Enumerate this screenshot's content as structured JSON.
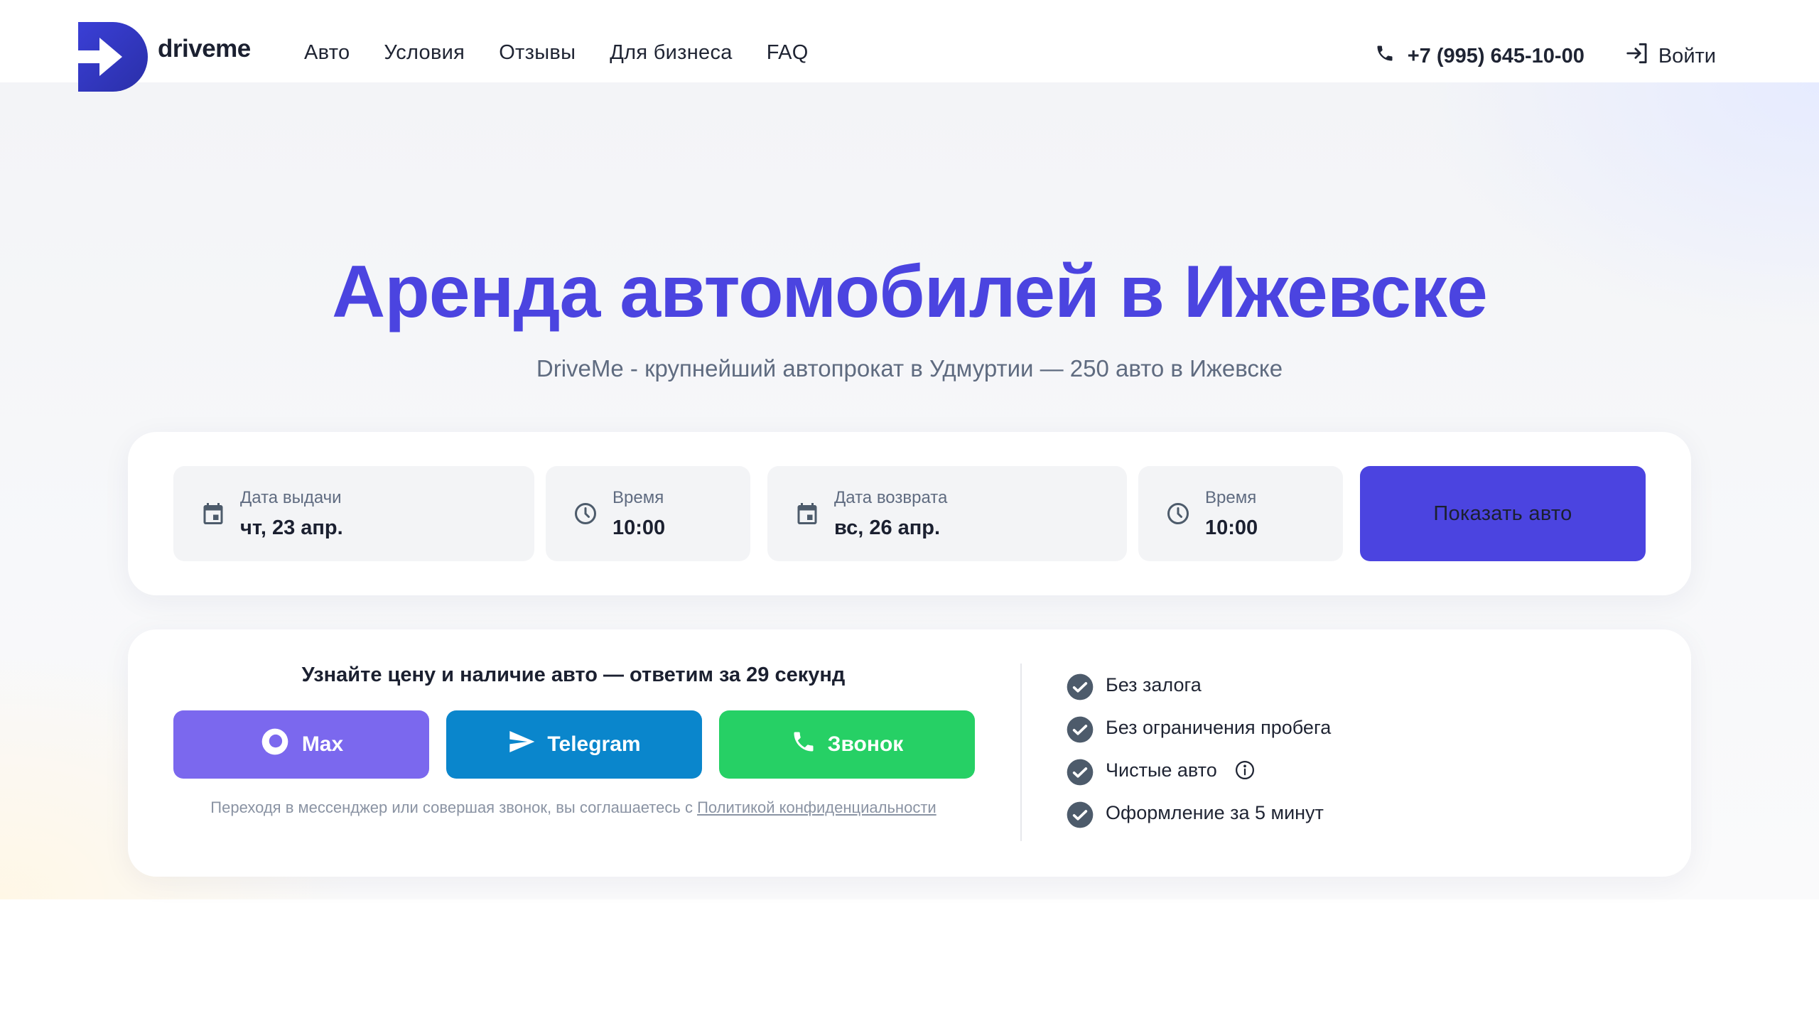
{
  "brand": {
    "name": "driveme"
  },
  "nav": {
    "items": [
      {
        "label": "Авто"
      },
      {
        "label": "Условия"
      },
      {
        "label": "Отзывы"
      },
      {
        "label": "Для бизнеса"
      },
      {
        "label": "FAQ"
      }
    ]
  },
  "header": {
    "phone": "+7 (995) 645-10-00",
    "login_label": "Войти"
  },
  "hero": {
    "title": "Аренда автомобилей в Ижевске",
    "subtitle": "DriveMe - крупнейший автопрокат в Удмуртии — 250 авто в Ижевске"
  },
  "search": {
    "pickup_date": {
      "label": "Дата выдачи",
      "value": "чт, 23 апр."
    },
    "pickup_time": {
      "label": "Время",
      "value": "10:00"
    },
    "return_date": {
      "label": "Дата возврата",
      "value": "вс, 26 апр."
    },
    "return_time": {
      "label": "Время",
      "value": "10:00"
    },
    "submit_label": "Показать авто"
  },
  "contact": {
    "title": "Узнайте цену и наличие авто — ответим за 29 секунд",
    "buttons": [
      {
        "label": "Max",
        "icon": "max-icon",
        "color": "#7b68ee"
      },
      {
        "label": "Telegram",
        "icon": "telegram-icon",
        "color": "#0a86cc"
      },
      {
        "label": "Звонок",
        "icon": "phone-icon",
        "color": "#26d065"
      }
    ],
    "policy_text": "Переходя в мессенджер или совершая звонок, вы соглашаетесь с",
    "policy_link": "Политикой конфиденциальности"
  },
  "features": [
    {
      "label": "Без залога"
    },
    {
      "label": "Без ограничения пробега"
    },
    {
      "label": "Чистые авто",
      "has_info": true
    },
    {
      "label": "Оформление за 5 минут"
    }
  ],
  "colors": {
    "accent": "#4b44e0",
    "max": "#7b68ee",
    "telegram": "#0a86cc",
    "call": "#26d065",
    "check": "#4d5b6b"
  }
}
